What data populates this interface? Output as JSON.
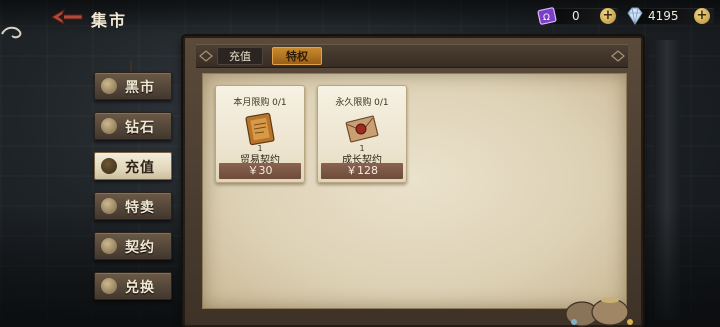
{
  "header": {
    "title": "集市"
  },
  "resources": [
    {
      "icon": "purple-ticket-icon",
      "value": "0",
      "color": "#8a4fd3"
    },
    {
      "icon": "diamond-icon",
      "value": "4195",
      "color": "#bcd3ea"
    }
  ],
  "nav": {
    "items": [
      {
        "label": "黑市",
        "icon": "black-market-icon",
        "active": false
      },
      {
        "label": "钻石",
        "icon": "diamond-nav-icon",
        "active": false
      },
      {
        "label": "充值",
        "icon": "coin-bag-icon",
        "active": true
      },
      {
        "label": "特卖",
        "icon": "sale-tag-icon",
        "active": false
      },
      {
        "label": "契约",
        "icon": "contract-icon",
        "active": false
      },
      {
        "label": "兑换",
        "icon": "exchange-icon",
        "active": false
      }
    ]
  },
  "tabs": [
    {
      "label": "充值",
      "active": false
    },
    {
      "label": "特权",
      "active": true
    }
  ],
  "products": [
    {
      "limit": "本月限购 0/1",
      "quantity": "1",
      "name": "贸易契约",
      "price": "￥30",
      "art": "scroll-icon"
    },
    {
      "limit": "永久限购 0/1",
      "quantity": "1",
      "name": "成长契约",
      "price": "￥128",
      "art": "sealed-letter-icon"
    }
  ],
  "colors": {
    "accent": "#c88a2e",
    "price_bg": "#7a5646",
    "parchment": "#e3d8bd"
  }
}
